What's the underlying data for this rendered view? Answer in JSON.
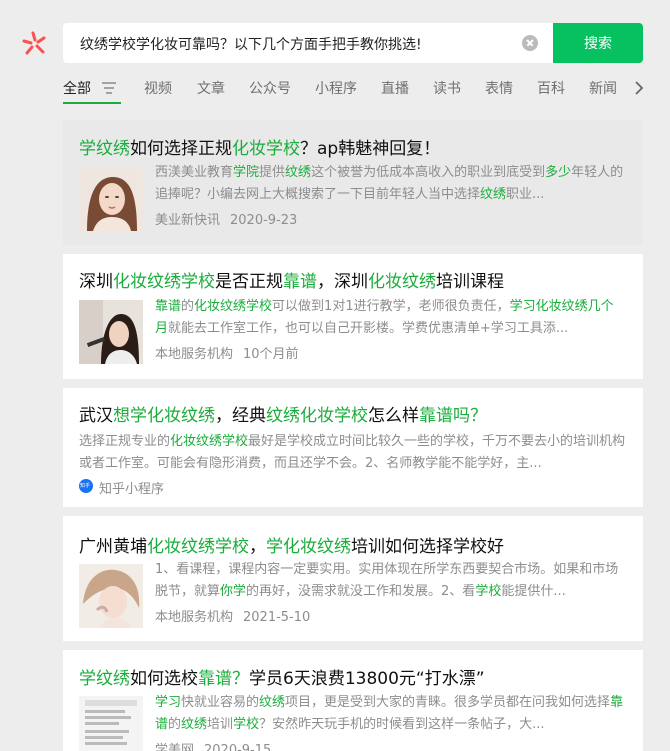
{
  "search": {
    "query": "纹绣学校学化妆可靠吗？以下几个方面手把手教你挑选!",
    "button_label": "搜索"
  },
  "tabs": [
    {
      "label": "全部"
    },
    {
      "label": "视频"
    },
    {
      "label": "文章"
    },
    {
      "label": "公众号"
    },
    {
      "label": "小程序"
    },
    {
      "label": "直播"
    },
    {
      "label": "读书"
    },
    {
      "label": "表情"
    },
    {
      "label": "百科"
    },
    {
      "label": "新闻"
    }
  ],
  "colors": {
    "accent": "#07c160",
    "highlight": "#1aad3b",
    "text_gray": "#8d8d8d"
  },
  "results": [
    {
      "title_parts": [
        [
          "学纹绣",
          true
        ],
        [
          "如何选择正规",
          false
        ],
        [
          "化妆学校",
          true
        ],
        [
          "？ap韩魅神回复！",
          false
        ]
      ],
      "snippet_parts": [
        [
          "西渼美业教育",
          false
        ],
        [
          "学院",
          true
        ],
        [
          "提供",
          false
        ],
        [
          "纹绣",
          true
        ],
        [
          "这个被誉为低成本高收入的职业到底受到",
          false
        ],
        [
          "多少",
          true
        ],
        [
          "年轻人的追捧呢？小编去网上大概搜索了一下目前年轻人当中选择",
          false
        ],
        [
          "纹绣",
          true
        ],
        [
          "职业...",
          false
        ]
      ],
      "source": "美业新快讯",
      "date": "2020-9-23"
    },
    {
      "title_parts": [
        [
          "深圳",
          false
        ],
        [
          "化妆纹绣学校",
          true
        ],
        [
          "是否正规",
          false
        ],
        [
          "靠谱",
          true
        ],
        [
          "，深圳",
          false
        ],
        [
          "化妆纹绣",
          true
        ],
        [
          "培训课程",
          false
        ]
      ],
      "snippet_parts": [
        [
          "靠谱",
          true
        ],
        [
          "的",
          false
        ],
        [
          "化妆纹绣学校",
          true
        ],
        [
          "可以做到1对1进行教学，老师很负责任，",
          false
        ],
        [
          "学习化妆纹绣几个月",
          true
        ],
        [
          "就能去工作室工作，也可以自己开影楼。学费优惠清单+学习工具添...",
          false
        ]
      ],
      "source": "本地服务机构",
      "date": "10个月前"
    },
    {
      "title_parts": [
        [
          "武汉",
          false
        ],
        [
          "想学化妆纹绣",
          true
        ],
        [
          "，经典",
          false
        ],
        [
          "纹绣化妆学校",
          true
        ],
        [
          "怎么样",
          false
        ],
        [
          "靠谱吗？",
          true
        ]
      ],
      "snippet_parts": [
        [
          "选择正规专业的",
          false
        ],
        [
          "化妆纹绣学校",
          true
        ],
        [
          "最好是学校成立时间比较久一些的学校，千万不要去小的培训机构或者工作室。可能会有隐形消费，而且还学不会。2、名师教学能不能学好，主...",
          false
        ]
      ],
      "source": "知乎小程序",
      "date": ""
    },
    {
      "title_parts": [
        [
          "广州黄埔",
          false
        ],
        [
          "化妆纹绣学校",
          true
        ],
        [
          "，",
          false
        ],
        [
          "学化妆纹绣",
          true
        ],
        [
          "培训如何选择学校好",
          false
        ]
      ],
      "snippet_parts": [
        [
          "1、看课程，课程内容一定要实用。实用体现在所学东西要契合市场。如果和市场脱节，就算",
          false
        ],
        [
          "你学",
          true
        ],
        [
          "的再好，没需求就没工作和发展。2、看",
          false
        ],
        [
          "学校",
          true
        ],
        [
          "能提供什...",
          false
        ]
      ],
      "source": "本地服务机构",
      "date": "2021-5-10"
    },
    {
      "title_parts": [
        [
          "学纹绣",
          true
        ],
        [
          "如何选校",
          false
        ],
        [
          "靠谱？",
          true
        ],
        [
          "学员6天浪费13800元“打水漂”",
          false
        ]
      ],
      "snippet_parts": [
        [
          "学习",
          true
        ],
        [
          "快就业容易的",
          false
        ],
        [
          "纹绣",
          true
        ],
        [
          "项目，更是受到大家的青睐。很多学员都在问我如何选择",
          false
        ],
        [
          "靠谱",
          true
        ],
        [
          "的",
          false
        ],
        [
          "纹绣",
          true
        ],
        [
          "培训",
          false
        ],
        [
          "学校",
          true
        ],
        [
          "？安然昨天玩手机的时候看到这样一条帖子，大...",
          false
        ]
      ],
      "source": "学美网",
      "date": "2020-9-15"
    }
  ]
}
